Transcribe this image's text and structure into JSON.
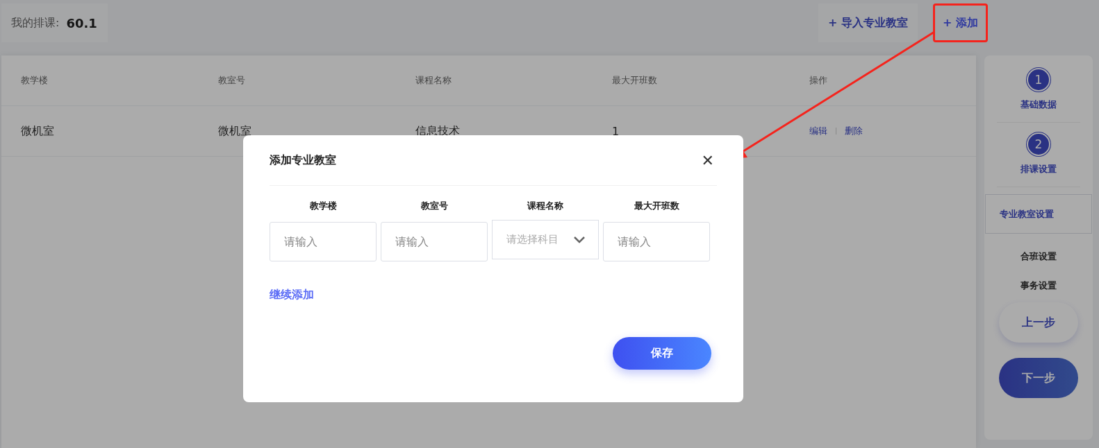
{
  "summary": {
    "label": "我的排课:",
    "value": "60.1"
  },
  "toolbar": [
    {
      "icon": "+",
      "label": "导入专业教室",
      "highlighted": false
    },
    {
      "icon": "+",
      "label": "添加",
      "highlighted": true
    }
  ],
  "table": {
    "columns": [
      "教学楼",
      "教室号",
      "课程名称",
      "最大开班数",
      "操作"
    ],
    "rows": [
      {
        "cells": [
          "微机室",
          "微机室",
          "信息技术",
          "1"
        ],
        "actions": [
          "编辑",
          "删除"
        ]
      }
    ]
  },
  "sidebar": {
    "steps": [
      {
        "number": "1",
        "label": "基础数据"
      },
      {
        "number": "2",
        "label": "排课设置"
      }
    ],
    "items": [
      {
        "label": "专业教室设置",
        "selected": true
      },
      {
        "label": "合班设置",
        "selected": false
      },
      {
        "label": "事务设置",
        "selected": false
      }
    ],
    "prev": "上一步",
    "next": "下一步"
  },
  "dialog": {
    "title": "添加专业教室",
    "close": "✕",
    "fields": [
      {
        "label": "教学楼",
        "placeholder": "请输入",
        "kind": "input"
      },
      {
        "label": "教室号",
        "placeholder": "请输入",
        "kind": "input"
      },
      {
        "label": "课程名称",
        "placeholder": "请选择科目",
        "kind": "select"
      },
      {
        "label": "最大开班数",
        "placeholder": "请输入",
        "kind": "input"
      }
    ],
    "add_more": "继续添加",
    "save": "保存"
  }
}
